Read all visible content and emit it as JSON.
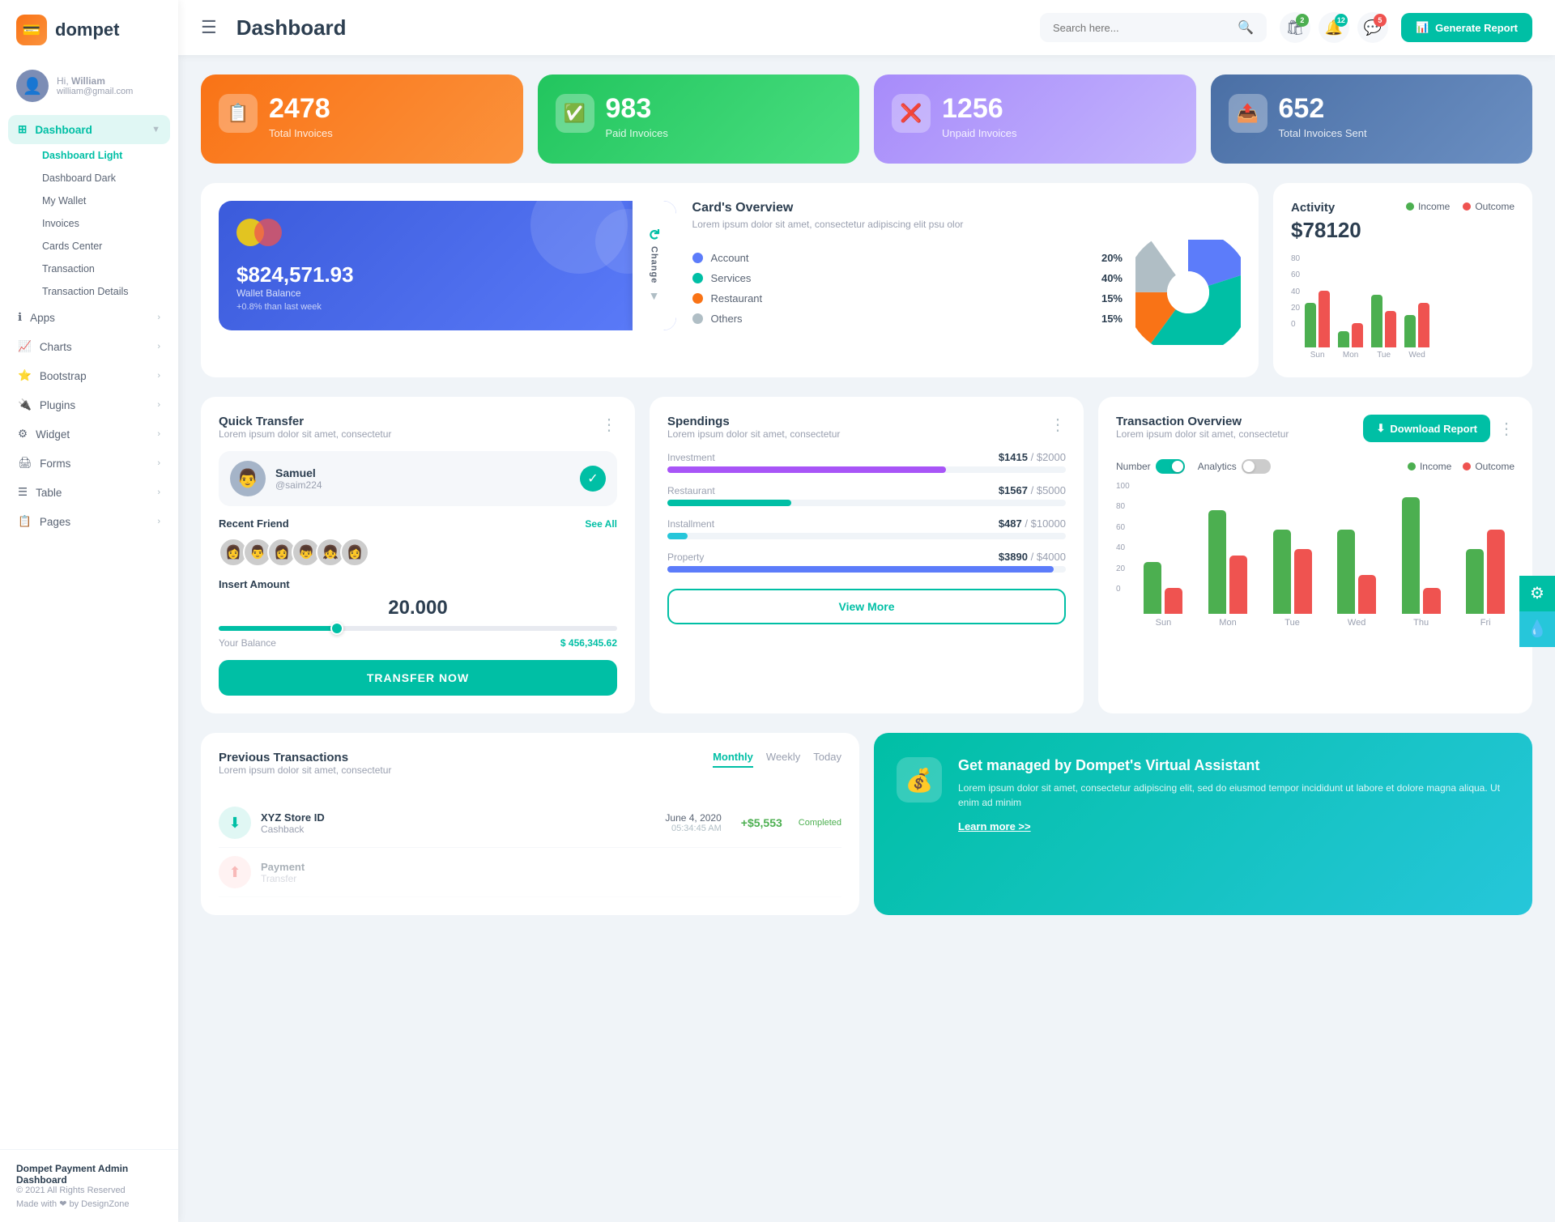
{
  "brand": {
    "name": "dompet",
    "logo_icon": "💳"
  },
  "user": {
    "hi": "Hi,",
    "name": "William",
    "email": "william@gmail.com"
  },
  "sidebar": {
    "hamburger": "☰",
    "dashboard_label": "Dashboard",
    "submenu": [
      {
        "label": "Dashboard Light",
        "active": true
      },
      {
        "label": "Dashboard Dark",
        "active": false
      },
      {
        "label": "My Wallet",
        "active": false
      },
      {
        "label": "Invoices",
        "active": false
      },
      {
        "label": "Cards Center",
        "active": false
      },
      {
        "label": "Transaction",
        "active": false
      },
      {
        "label": "Transaction Details",
        "active": false
      }
    ],
    "nav_items": [
      {
        "id": "apps",
        "label": "Apps",
        "icon": "ℹ️"
      },
      {
        "id": "charts",
        "label": "Charts",
        "icon": "📈"
      },
      {
        "id": "bootstrap",
        "label": "Bootstrap",
        "icon": "⭐"
      },
      {
        "id": "plugins",
        "label": "Plugins",
        "icon": "🔌"
      },
      {
        "id": "widget",
        "label": "Widget",
        "icon": "⚙️"
      },
      {
        "id": "forms",
        "label": "Forms",
        "icon": "🖨️"
      },
      {
        "id": "table",
        "label": "Table",
        "icon": "☰"
      },
      {
        "id": "pages",
        "label": "Pages",
        "icon": "📋"
      }
    ],
    "footer_brand": "Dompet Payment Admin Dashboard",
    "footer_copy": "© 2021 All Rights Reserved",
    "footer_made": "Made with ❤ by DesignZone"
  },
  "topbar": {
    "title": "Dashboard",
    "search_placeholder": "Search here...",
    "search_icon": "🔍",
    "notifications": [
      {
        "icon": "🛍️",
        "badge": "2",
        "badge_color": "green"
      },
      {
        "icon": "🔔",
        "badge": "12",
        "badge_color": "teal"
      },
      {
        "icon": "💬",
        "badge": "5",
        "badge_color": "red"
      }
    ],
    "generate_btn": "Generate Report"
  },
  "stats": [
    {
      "id": "total-invoices",
      "number": "2478",
      "label": "Total Invoices",
      "icon": "📋",
      "color": "orange"
    },
    {
      "id": "paid-invoices",
      "number": "983",
      "label": "Paid Invoices",
      "icon": "✅",
      "color": "green"
    },
    {
      "id": "unpaid-invoices",
      "number": "1256",
      "label": "Unpaid Invoices",
      "icon": "❌",
      "color": "purple"
    },
    {
      "id": "total-sent",
      "number": "652",
      "label": "Total Invoices Sent",
      "icon": "📤",
      "color": "teal-dark"
    }
  ],
  "wallet": {
    "balance": "$824,571.93",
    "label": "Wallet Balance",
    "sub": "+0.8% than last week",
    "change_btn": "Change"
  },
  "card_overview": {
    "title": "Card's Overview",
    "desc": "Lorem ipsum dolor sit amet, consectetur adipiscing elit psu olor",
    "legend": [
      {
        "label": "Account",
        "pct": "20%",
        "color": "#5c7cfa"
      },
      {
        "label": "Services",
        "pct": "40%",
        "color": "#00bfa5"
      },
      {
        "label": "Restaurant",
        "pct": "15%",
        "color": "#f97316"
      },
      {
        "label": "Others",
        "pct": "15%",
        "color": "#b0bec5"
      }
    ],
    "pie": [
      {
        "label": "Account",
        "value": 20,
        "color": "#5c7cfa"
      },
      {
        "label": "Services",
        "value": 40,
        "color": "#00bfa5"
      },
      {
        "label": "Restaurant",
        "value": 15,
        "color": "#f97316"
      },
      {
        "label": "Others",
        "value": 15,
        "color": "#b0bec5"
      },
      {
        "label": "Gray",
        "value": 10,
        "color": "#d0d8e0"
      }
    ]
  },
  "activity": {
    "title": "Activity",
    "amount": "$78120",
    "legend": [
      {
        "label": "Income",
        "color": "#4caf50"
      },
      {
        "label": "Outcome",
        "color": "#ef5350"
      }
    ],
    "bars": [
      {
        "day": "Sun",
        "income": 55,
        "outcome": 70
      },
      {
        "day": "Mon",
        "income": 20,
        "outcome": 30
      },
      {
        "day": "Tue",
        "income": 65,
        "outcome": 45
      },
      {
        "day": "Wed",
        "income": 40,
        "outcome": 55
      }
    ],
    "y_labels": [
      "80",
      "60",
      "40",
      "20",
      "0"
    ]
  },
  "quick_transfer": {
    "title": "Quick Transfer",
    "desc": "Lorem ipsum dolor sit amet, consectetur",
    "user": {
      "name": "Samuel",
      "handle": "@saim224"
    },
    "recent_friends_title": "Recent Friend",
    "see_all": "See All",
    "friends": [
      "👩",
      "👨",
      "👩",
      "👦",
      "👧",
      "👩"
    ],
    "insert_amount_label": "Insert Amount",
    "amount": "20.000",
    "balance_label": "Your Balance",
    "balance": "$ 456,345.62",
    "transfer_btn": "TRANSFER NOW"
  },
  "spendings": {
    "title": "Spendings",
    "desc": "Lorem ipsum dolor sit amet, consectetur",
    "items": [
      {
        "label": "Investment",
        "amount": "$1415",
        "max": "$2000",
        "pct": 70,
        "color": "#a855f7"
      },
      {
        "label": "Restaurant",
        "amount": "$1567",
        "max": "$5000",
        "pct": 31,
        "color": "#00bfa5"
      },
      {
        "label": "Installment",
        "amount": "$487",
        "max": "$10000",
        "pct": 5,
        "color": "#26c6da"
      },
      {
        "label": "Property",
        "amount": "$3890",
        "max": "$4000",
        "pct": 97,
        "color": "#5c7cfa"
      }
    ],
    "view_more_btn": "View More"
  },
  "transaction_overview": {
    "title": "Transaction Overview",
    "desc": "Lorem ipsum dolor sit amet, consectetur",
    "number_toggle": {
      "label": "Number",
      "state": "on"
    },
    "analytics_toggle": {
      "label": "Analytics",
      "state": "off"
    },
    "download_btn": "Download Report",
    "legend": [
      {
        "label": "Income",
        "color": "#4caf50"
      },
      {
        "label": "Outcome",
        "color": "#ef5350"
      }
    ],
    "bars": [
      {
        "day": "Sun",
        "income": 40,
        "outcome": 20
      },
      {
        "day": "Mon",
        "income": 80,
        "outcome": 45
      },
      {
        "day": "Tue",
        "income": 65,
        "outcome": 50
      },
      {
        "day": "Wed",
        "income": 65,
        "outcome": 30
      },
      {
        "day": "Thu",
        "income": 90,
        "outcome": 20
      },
      {
        "day": "Fri",
        "income": 50,
        "outcome": 65
      }
    ],
    "y_labels": [
      "100",
      "80",
      "60",
      "40",
      "20",
      "0"
    ]
  },
  "prev_transactions": {
    "title": "Previous Transactions",
    "desc": "Lorem ipsum dolor sit amet, consectetur",
    "tabs": [
      "Monthly",
      "Weekly",
      "Today"
    ],
    "active_tab": "Monthly",
    "rows": [
      {
        "icon": "⬇️",
        "icon_bg": "#e0f7f4",
        "name": "XYZ Store ID",
        "type": "Cashback",
        "date": "June 4, 2020",
        "time": "05:34:45 AM",
        "amount": "+$5,553",
        "status": "Completed",
        "amount_color": "#4caf50"
      }
    ]
  },
  "banner": {
    "icon": "💰",
    "title": "Get managed by Dompet's Virtual Assistant",
    "desc": "Lorem ipsum dolor sit amet, consectetur adipiscing elit, sed do eiusmod tempor incididunt ut labore et dolore magna aliqua. Ut enim ad minim",
    "link": "Learn more >>"
  },
  "float_btns": [
    {
      "icon": "⚙️",
      "color": "teal"
    },
    {
      "icon": "💧",
      "color": "blue"
    }
  ]
}
